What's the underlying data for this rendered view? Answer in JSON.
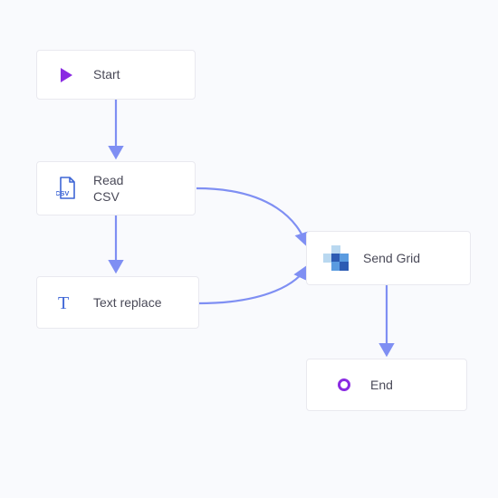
{
  "nodes": {
    "start": {
      "label": "Start"
    },
    "readcsv": {
      "label1": "Read",
      "label2": "CSV"
    },
    "textreplace": {
      "label": "Text replace"
    },
    "sendgrid": {
      "label": "Send Grid"
    },
    "end": {
      "label": "End"
    }
  },
  "colors": {
    "accent": "#8a2be2",
    "connector": "#7f8ff3",
    "csvBlue": "#3e66d6",
    "textT": "#3e66d6",
    "sgDark": "#2d5bb3",
    "sgMid": "#5a9be0",
    "sgLight": "#b9d8f0"
  }
}
